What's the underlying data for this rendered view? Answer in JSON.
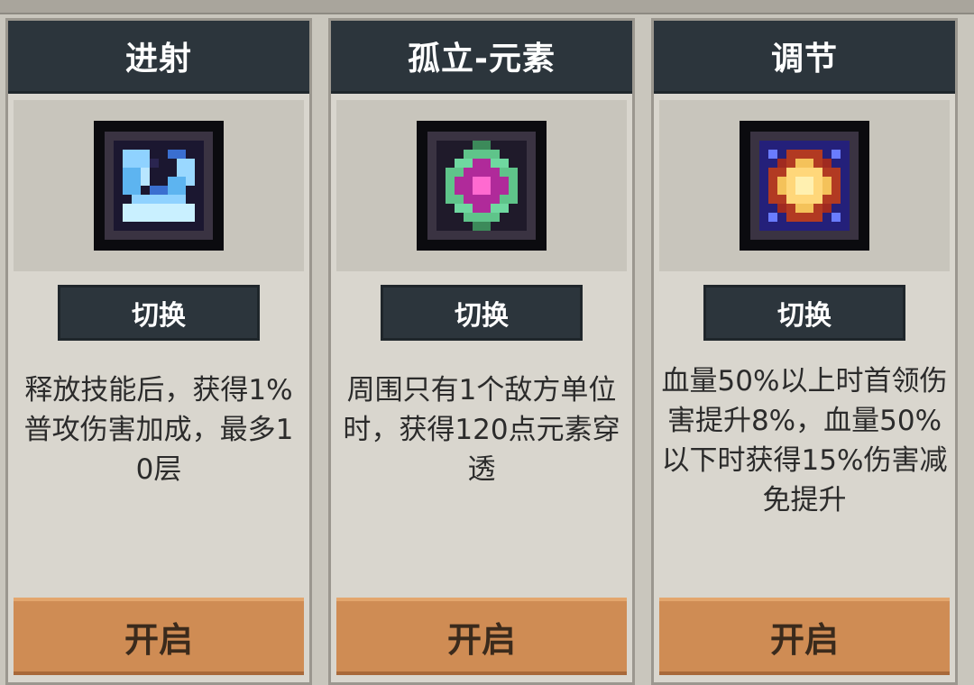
{
  "cards": [
    {
      "title": "进射",
      "icon": "shard-burst-icon",
      "switch_label": "切换",
      "description": "释放技能后，获得1%普攻伤害加成，最多10层",
      "open_label": "开启"
    },
    {
      "title": "孤立-元素",
      "icon": "element-gem-icon",
      "switch_label": "切换",
      "description": "周围只有1个敌方单位时，获得120点元素穿透",
      "open_label": "开启"
    },
    {
      "title": "调节",
      "icon": "star-cross-icon",
      "switch_label": "切换",
      "description": "血量50%以上时首领伤害提升8%，血量50%以下时获得15%伤害减免提升",
      "open_label": "开启"
    }
  ],
  "colors": {
    "header_bg": "#2c353c",
    "card_bg": "#d9d6ce",
    "open_button": "#cf8c54",
    "text": "#2b2b2b"
  }
}
